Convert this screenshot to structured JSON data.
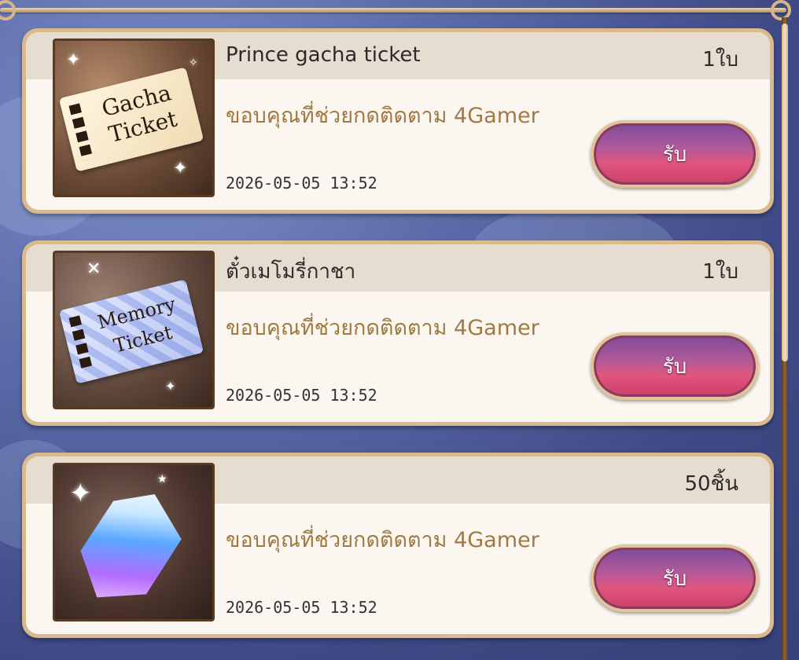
{
  "rewards": [
    {
      "title": "Prince gacha ticket",
      "quantity": "1ใบ",
      "message": "ขอบคุณที่ช่วยกดติดตาม 4Gamer",
      "date": "2026-05-05 13:52",
      "button_label": "รับ",
      "thumbnail": {
        "icon": "gacha-ticket-icon",
        "text_line1": "Gacha",
        "text_line2": "Ticket"
      }
    },
    {
      "title": "ตั๋วเมโมรี่กาชา",
      "quantity": "1ใบ",
      "message": "ขอบคุณที่ช่วยกดติดตาม 4Gamer",
      "date": "2026-05-05 13:52",
      "button_label": "รับ",
      "thumbnail": {
        "icon": "memory-ticket-icon",
        "text_line1": "Memory",
        "text_line2": "Ticket"
      }
    },
    {
      "title": "",
      "quantity": "50ชิ้น",
      "message": "ขอบคุณที่ช่วยกดติดตาม 4Gamer",
      "date": "2026-05-05 13:52",
      "button_label": "รับ",
      "thumbnail": {
        "icon": "jewel-crystal-icon"
      }
    }
  ],
  "colors": {
    "card_border": "#d9b98e",
    "message_text": "#a07a42",
    "button_pink": "#e0567e",
    "button_purple": "#7d4a9a"
  }
}
